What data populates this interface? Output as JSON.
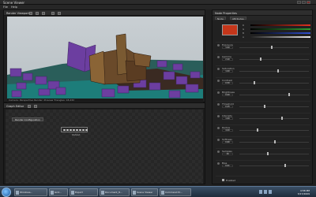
{
  "window": {
    "title": "Scene Viewer"
  },
  "menu": [
    "File",
    "Help"
  ],
  "viewport": {
    "title": "Render Viewport",
    "status": "Camera: Perspective    Render: Preview    Triangles: 18,432"
  },
  "graph": {
    "title": "Graph Editor",
    "node_tag": "Render Configuration",
    "node_label": "Output"
  },
  "right_panel": {
    "title": "Node Properties",
    "tabs": [
      "Node",
      "Attributes"
    ],
    "color_labels": [
      "R",
      "G",
      "B",
      "A"
    ],
    "rows": [
      {
        "label": "Exposure",
        "value": "1.00"
      },
      {
        "label": "Gamma",
        "value": "2.20"
      },
      {
        "label": "Saturation",
        "value": "1.00"
      },
      {
        "label": "Contrast",
        "value": "0.50"
      },
      {
        "label": "Brightness",
        "value": "0.00"
      },
      {
        "label": "Threshold",
        "value": "0.25"
      },
      {
        "label": "Intensity",
        "value": "1.00"
      },
      {
        "label": "Radius",
        "value": "4.00"
      },
      {
        "label": "Softness",
        "value": "0.60"
      },
      {
        "label": "Samples",
        "value": "16"
      },
      {
        "label": "Bias",
        "value": "0.01"
      }
    ],
    "check_label": "Enabled"
  },
  "taskbar": {
    "tasks": [
      "Windows...",
      "Grid...",
      "Export",
      "Document_8...",
      "Scene Viewer",
      "Command Pr..."
    ],
    "clock_time": "4:58 PM",
    "clock_date": "3/17/2009"
  },
  "colors": {
    "swatch": "#c4361a",
    "purple": "#6c3ea0",
    "teal": "#1f7c78"
  }
}
